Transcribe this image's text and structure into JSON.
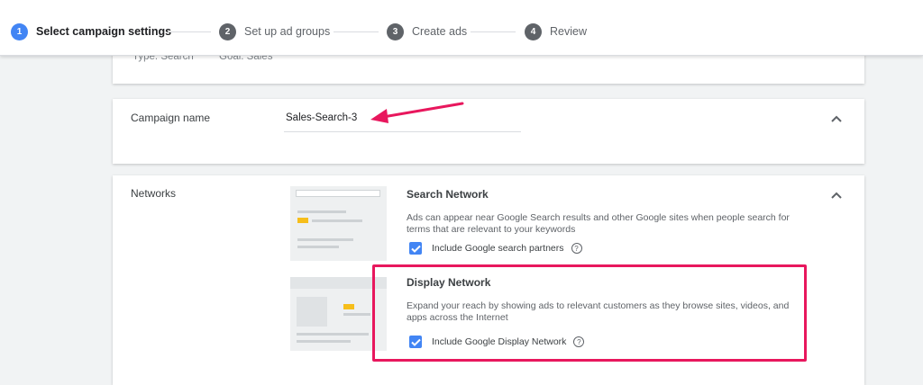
{
  "stepper": {
    "steps": [
      {
        "num": "1",
        "label": "Select campaign settings"
      },
      {
        "num": "2",
        "label": "Set up ad groups"
      },
      {
        "num": "3",
        "label": "Create ads"
      },
      {
        "num": "4",
        "label": "Review"
      }
    ]
  },
  "summary": {
    "type": "Type: Search",
    "goal": "Goal: Sales"
  },
  "campaign": {
    "label": "Campaign name",
    "value": "Sales-Search-3"
  },
  "networks": {
    "label": "Networks",
    "search": {
      "title": "Search Network",
      "description": "Ads can appear near Google Search results and other Google sites when people search for terms that are relevant to your keywords",
      "checkbox_label": "Include Google search partners",
      "checked": true
    },
    "display": {
      "title": "Display Network",
      "description": "Expand your reach by showing ads to relevant customers as they browse sites, videos, and apps across the Internet",
      "checkbox_label": "Include Google Display Network",
      "checked": true
    }
  },
  "colors": {
    "accent": "#4285f4",
    "highlight": "#e8175d",
    "annotation_arrow": "#e8175d",
    "ad_marker": "#f6be1b"
  },
  "icons": [
    "check-icon",
    "help-icon",
    "chevron-up-icon",
    "annotation-arrow"
  ]
}
